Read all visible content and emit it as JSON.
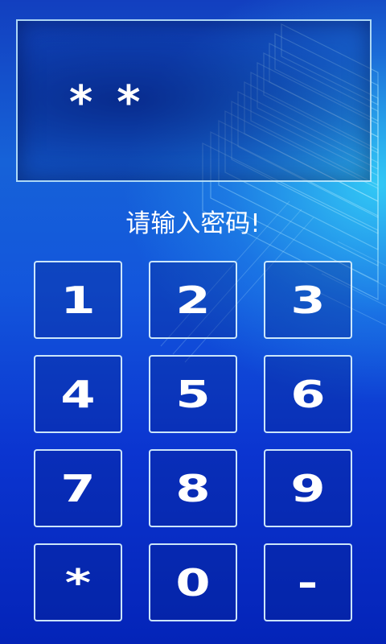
{
  "display": {
    "value": "**"
  },
  "prompt": "请输入密码!",
  "keypad": {
    "keys": [
      "1",
      "2",
      "3",
      "4",
      "5",
      "6",
      "7",
      "8",
      "9",
      "*",
      "0",
      "-"
    ]
  },
  "colors": {
    "background_top": "#123fbf",
    "background_bottom": "#0424b8",
    "glow": "#3cebff",
    "border": "#dcf5ff",
    "text": "#ffffff"
  }
}
